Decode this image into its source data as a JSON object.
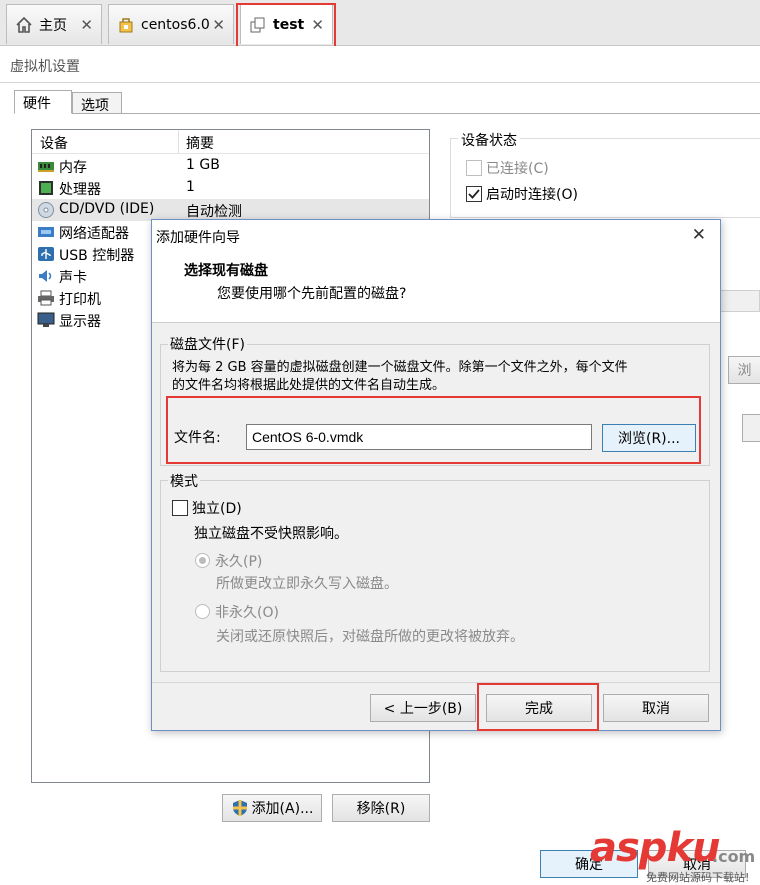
{
  "tabs": [
    {
      "label": "主页",
      "icon": "home-icon"
    },
    {
      "label": "centos6.0",
      "icon": "vm-icon"
    },
    {
      "label": "test",
      "icon": "vm-clone-icon",
      "active": true
    }
  ],
  "window": {
    "title": "虚拟机设置",
    "tabs": [
      "硬件",
      "选项"
    ]
  },
  "device_list": {
    "headers": [
      "设备",
      "摘要"
    ],
    "rows": [
      {
        "name": "内存",
        "summary": "1 GB",
        "icon": "memory-icon"
      },
      {
        "name": "处理器",
        "summary": "1",
        "icon": "cpu-icon"
      },
      {
        "name": "CD/DVD (IDE)",
        "summary": "自动检测",
        "icon": "cdrom-icon",
        "selected": true
      },
      {
        "name": "网络适配器",
        "summary": "",
        "icon": "network-icon"
      },
      {
        "name": "USB 控制器",
        "summary": "",
        "icon": "usb-icon"
      },
      {
        "name": "声卡",
        "summary": "",
        "icon": "sound-icon"
      },
      {
        "name": "打印机",
        "summary": "",
        "icon": "printer-icon"
      },
      {
        "name": "显示器",
        "summary": "",
        "icon": "monitor-icon"
      }
    ],
    "add_button": "添加(A)...",
    "remove_button": "移除(R)"
  },
  "device_status": {
    "title": "设备状态",
    "connected": "已连接(C)",
    "connect_on_start": "启动时连接(O)",
    "browse_partial": "浏"
  },
  "dialog": {
    "title": "添加硬件向导",
    "heading": "选择现有磁盘",
    "subheading": "您要使用哪个先前配置的磁盘?",
    "disk_file_group": "磁盘文件(F)",
    "disk_file_desc_line1": "将为每 2 GB 容量的虚拟磁盘创建一个磁盘文件。除第一个文件之外，每个文件",
    "disk_file_desc_line2": "的文件名均将根据此处提供的文件名自动生成。",
    "file_label": "文件名:",
    "file_value": "CentOS 6-0.vmdk",
    "browse_button": "浏览(R)...",
    "mode_group": "模式",
    "independent_label": "独立(D)",
    "independent_desc": "独立磁盘不受快照影响。",
    "persistent_label": "永久(P)",
    "persistent_desc": "所做更改立即永久写入磁盘。",
    "nonpersistent_label": "非永久(O)",
    "nonpersistent_desc": "关闭或还原快照后，对磁盘所做的更改将被放弃。",
    "back_button": "< 上一步(B)",
    "finish_button": "完成",
    "cancel_button": "取消"
  },
  "footer": {
    "ok_button": "确定",
    "cancel_partial": "取消"
  },
  "watermark": {
    "brand_a": "asp",
    "brand_b": "ku",
    "domain": ".com",
    "slogan": "免费网站源码下载站!"
  },
  "colors": {
    "highlight_red": "#e53935",
    "dialog_border": "#6c8fc7"
  }
}
